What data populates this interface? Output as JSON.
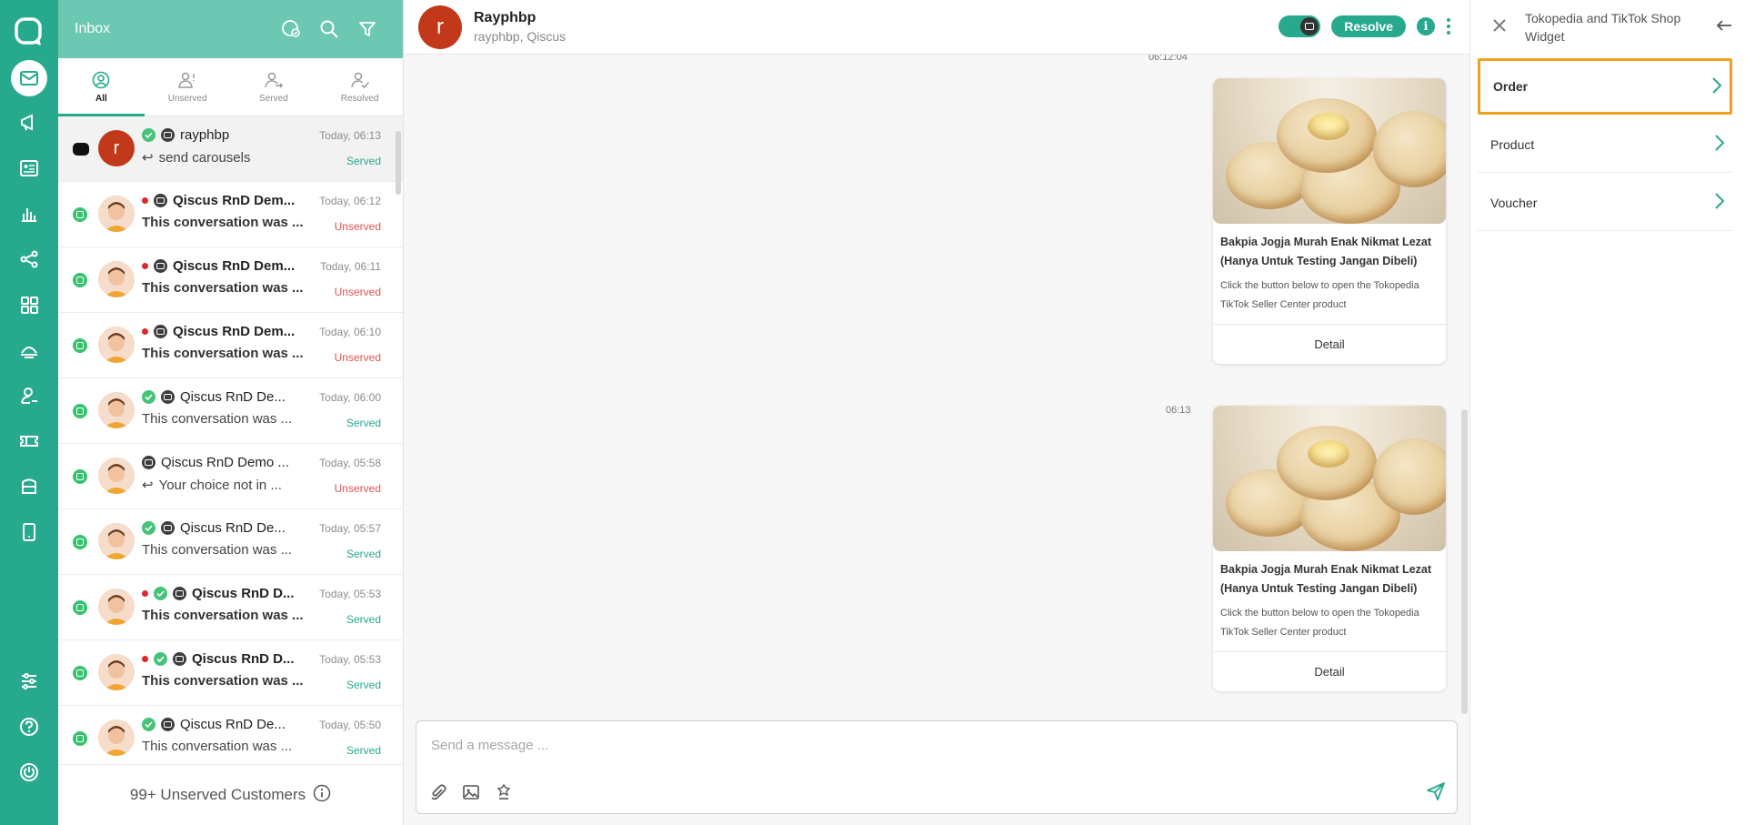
{
  "inbox": {
    "title": "Inbox",
    "tabs": [
      {
        "label": "All"
      },
      {
        "label": "Unserved"
      },
      {
        "label": "Served"
      },
      {
        "label": "Resolved"
      }
    ],
    "conversations": [
      {
        "name": "rayphbp",
        "preview": "send carousels",
        "time": "Today, 06:13",
        "status": "Served"
      },
      {
        "name": "Qiscus RnD Dem...",
        "preview": "This conversation was ...",
        "time": "Today, 06:12",
        "status": "Unserved"
      },
      {
        "name": "Qiscus RnD Dem...",
        "preview": "This conversation was ...",
        "time": "Today, 06:11",
        "status": "Unserved"
      },
      {
        "name": "Qiscus RnD Dem...",
        "preview": "This conversation was ...",
        "time": "Today, 06:10",
        "status": "Unserved"
      },
      {
        "name": "Qiscus RnD De...",
        "preview": "This conversation was ...",
        "time": "Today, 06:00",
        "status": "Served"
      },
      {
        "name": "Qiscus RnD Demo ...",
        "preview": "Your choice not in ...",
        "time": "Today, 05:58",
        "status": "Unserved"
      },
      {
        "name": "Qiscus RnD De...",
        "preview": "This conversation was ...",
        "time": "Today, 05:57",
        "status": "Served"
      },
      {
        "name": "Qiscus RnD D...",
        "preview": "This conversation was ...",
        "time": "Today, 05:53",
        "status": "Served"
      },
      {
        "name": "Qiscus RnD D...",
        "preview": "This conversation was ...",
        "time": "Today, 05:53",
        "status": "Served"
      },
      {
        "name": "Qiscus RnD De...",
        "preview": "This conversation was ...",
        "time": "Today, 05:50",
        "status": "Served"
      }
    ],
    "unserved_footer": "99+ Unserved Customers"
  },
  "chat": {
    "avatar_letter": "r",
    "contact_name": "Rayphbp",
    "contact_sub": "rayphbp, Qiscus",
    "resolve_label": "Resolve",
    "messages": [
      {
        "time": "06:12:04",
        "title": "Bakpia Jogja Murah Enak Nikmat Lezat (Hanya Untuk Testing Jangan Dibeli)",
        "description": "Click the button below to open the Tokopedia TikTok Seller Center product",
        "button": "Detail"
      },
      {
        "time": "06:13",
        "title": "Bakpia Jogja Murah Enak Nikmat Lezat (Hanya Untuk Testing Jangan Dibeli)",
        "description": "Click the button below to open the Tokopedia TikTok Seller Center product",
        "button": "Detail"
      }
    ],
    "composer_placeholder": "Send a message ..."
  },
  "widget": {
    "title": "Tokopedia and TikTok Shop Widget",
    "items": [
      {
        "label": "Order"
      },
      {
        "label": "Product"
      },
      {
        "label": "Voucher"
      }
    ]
  },
  "colors": {
    "brand": "#27a98e",
    "header_light": "#6cc8b2",
    "served": "#27a98e",
    "unserved": "#e05252",
    "focus_outline": "#f0a21c",
    "avatar_letter_bg": "#c1381a"
  },
  "icons": {
    "rail": [
      "chat-logo-icon",
      "inbox-icon",
      "broadcast-icon",
      "contact-card-icon",
      "analytics-icon",
      "integration-icon",
      "apps-icon",
      "bot-icon",
      "agent-icon",
      "ticket-icon",
      "storage-icon",
      "mobile-icon",
      "settings-icon",
      "help-icon",
      "power-icon"
    ],
    "inbox_header": [
      "channel-status-icon",
      "search-icon",
      "filter-icon"
    ],
    "composer": [
      "attachment-icon",
      "image-icon",
      "template-icon",
      "send-icon"
    ]
  }
}
